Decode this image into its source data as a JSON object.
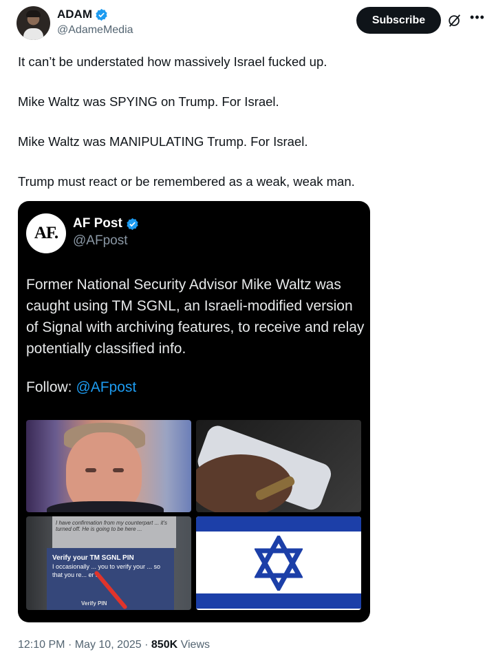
{
  "author": {
    "display_name": "ADAM",
    "handle": "@AdameMedia",
    "verified": true
  },
  "actions": {
    "subscribe_label": "Subscribe",
    "grok_icon": "grok-icon",
    "more_icon": "more-icon"
  },
  "tweet": {
    "paragraphs": [
      "It can’t be understated how massively Israel fucked up.",
      "Mike Waltz was SPYING on Trump. For Israel.",
      "Mike Waltz was MANIPULATING Trump. For Israel.",
      "Trump must react or be remembered as a weak, weak man."
    ]
  },
  "embedded": {
    "avatar_text": "AF.",
    "name": "AF Post",
    "handle": "@AFpost",
    "verified": true,
    "body": "Former National Security Advisor Mike Waltz was caught using TM SGNL, an Israeli-modified version of Signal with archiving features, to receive and relay potentially classified info.",
    "follow_label": "Follow:",
    "follow_link": "@AFpost",
    "screen_note": "I have confirmation from my counterpart ... it's turned off. He is going to be here ...",
    "screen_title": "Verify your TM SGNL PIN",
    "screen_body": "I occasionally ... you to verify your ... so that you re... er it.",
    "screen_button": "Verify PIN"
  },
  "footer": {
    "time": "12:10 PM",
    "date": "May 10, 2025",
    "views_count": "850K",
    "views_label": "Views"
  },
  "colors": {
    "accent": "#1d9bf0",
    "flag_blue": "#1c3fa8",
    "text": "#0f1419",
    "muted": "#536471"
  }
}
